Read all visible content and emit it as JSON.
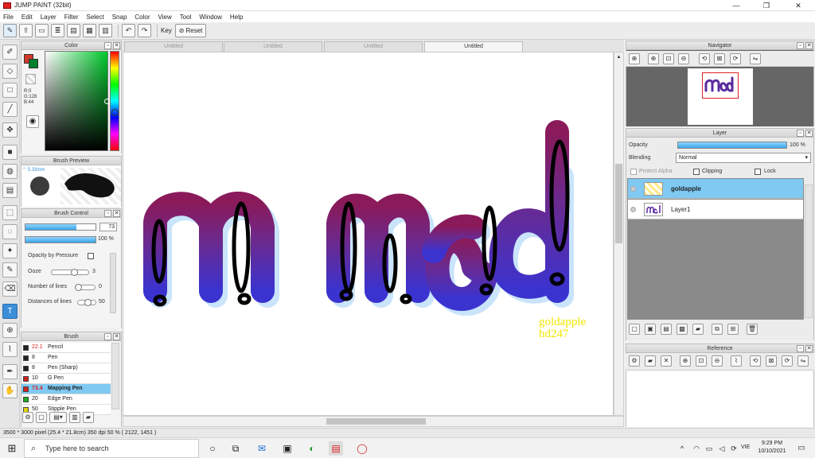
{
  "window": {
    "title": "JUMP PAINT (32bit)",
    "minimize": "—",
    "maximize": "❐",
    "close": "✕"
  },
  "menu": [
    "File",
    "Edit",
    "Layer",
    "Filter",
    "Select",
    "Snap",
    "Color",
    "View",
    "Tool",
    "Window",
    "Help"
  ],
  "toolbar": {
    "key_label": "Key",
    "reset_label": "Reset"
  },
  "panels": {
    "color": {
      "title": "Color",
      "rgb": [
        "R:0",
        "G:128",
        "B:44"
      ],
      "foreground": "#00802c",
      "background": "#d23a2a"
    },
    "brush_preview": {
      "title": "Brush Preview",
      "size": "5.33mm"
    },
    "brush_control": {
      "title": "Brush Control",
      "size_value": "73",
      "size_fraction": 0.73,
      "opacity_value": "100 %",
      "opacity_fraction": 1.0,
      "opacity_by_pressure": "Opacity by Pressure",
      "ooze_label": "Ooze",
      "ooze_value": "3",
      "lines_label": "Number of lines",
      "lines_value": "0",
      "distances_label": "Distances of lines",
      "distances_value": "50"
    },
    "brush": {
      "title": "Brush",
      "items": [
        {
          "size": "22.1",
          "name": "Pencil",
          "color": "#222222"
        },
        {
          "size": "8",
          "name": "Pen",
          "color": "#222222"
        },
        {
          "size": "8",
          "name": "Pen (Sharp)",
          "color": "#222222"
        },
        {
          "size": "10",
          "name": "G Pen",
          "color": "#d22020"
        },
        {
          "size": "73.4",
          "name": "Mapping Pen",
          "color": "#d22020"
        },
        {
          "size": "20",
          "name": "Edge Pen",
          "color": "#22aa22"
        },
        {
          "size": "50",
          "name": "Stipple Pen",
          "color": "#e0d000"
        }
      ]
    },
    "navigator": {
      "title": "Navigator"
    },
    "layer": {
      "title": "Layer",
      "opacity_label": "Opacity",
      "opacity_value": "100 %",
      "opacity_fraction": 1.0,
      "blending_label": "Blending",
      "blending_value": "Normal",
      "protect_alpha": "Protect Alpha",
      "clipping": "Clipping",
      "lock": "Lock",
      "layers": [
        {
          "name": "goldapple",
          "selected": true
        },
        {
          "name": "Layer1",
          "selected": false
        }
      ]
    },
    "reference": {
      "title": "Reference"
    }
  },
  "tabs": [
    "Untitled",
    "Untitled",
    "Untitled",
    "Untitled"
  ],
  "artwork": {
    "signature_line1": "goldapple",
    "signature_line2": "hd247"
  },
  "status": "3500 * 3000 pixel  (25.4 * 21.8cm)  350 dpi  50 %  ( 2122, 1451 )",
  "taskbar": {
    "search_placeholder": "Type here to search",
    "lang": "VIE",
    "time": "9:29 PM",
    "date": "10/10/2021"
  }
}
